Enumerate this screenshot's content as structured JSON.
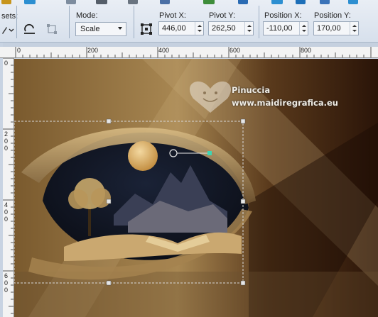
{
  "toolbar": {
    "presets_label": "sets:",
    "mode_label": "Mode:",
    "mode_value": "Scale",
    "pivot_x_label": "Pivot X:",
    "pivot_x_value": "446,00",
    "pivot_y_label": "Pivot Y:",
    "pivot_y_value": "262,50",
    "position_x_label": "Position X:",
    "position_x_value": "-110,00",
    "position_y_label": "Position Y:",
    "position_y_value": "170,00"
  },
  "rulers": {
    "h_ticks": [
      "0",
      "200",
      "400",
      "600",
      "800"
    ],
    "v_ticks": [
      "2",
      "0",
      "0",
      "4",
      "0",
      "0",
      "6",
      "0",
      "0"
    ]
  },
  "canvas": {
    "watermark_name": "Pinuccia",
    "watermark_url": "www.maidiregrafica.eu"
  },
  "colors": {
    "accent_teal": "#3dd6b4",
    "bg_dark": "#2a1a0e",
    "bg_gold": "#b48a4a"
  }
}
